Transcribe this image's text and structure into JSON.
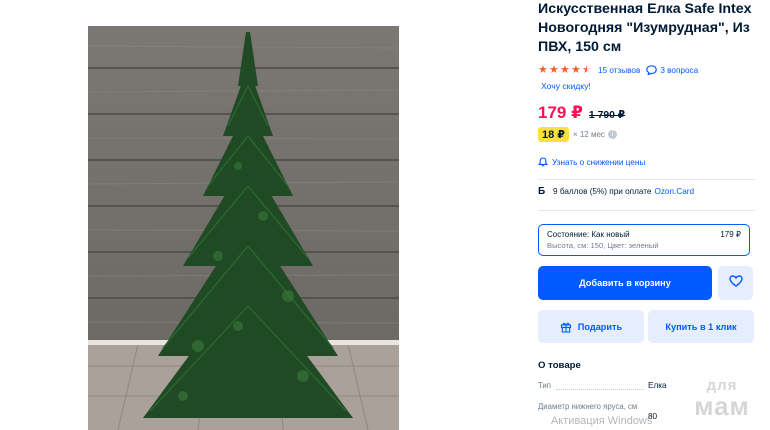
{
  "product": {
    "title": "Искусственная Елка Safe Intex Новогодняя \"Изумрудная\", Из ПВХ, 150 см",
    "rating_stars": 4.5,
    "reviews_link": "15 отзывов",
    "questions_link": "3 вопроса",
    "discount_link": "Хочу скидку!",
    "price": "179 ₽",
    "old_price": "1 790 ₽",
    "installment_amount": "18 ₽",
    "installment_term": "× 12 мес",
    "info_icon_glyph": "i",
    "notify_link": "Узнать о снижении цены",
    "bonus_icon": "Б",
    "bonus_text": "9 баллов (5%) при оплате",
    "bonus_link": "Ozon.Card"
  },
  "variant": {
    "condition": "Состояние: Как новый",
    "price": "179 ₽",
    "details": "Высота, см: 150, Цвет: зеленый"
  },
  "actions": {
    "add_to_cart": "Добавить в корзину",
    "gift": "Подарить",
    "buy_one_click": "Купить в 1 клик"
  },
  "about": {
    "title": "О товаре",
    "specs": [
      {
        "label": "Тип",
        "value": "Елка"
      },
      {
        "label": "Диаметр нижнего яруса, см",
        "value": "80"
      }
    ]
  },
  "overlays": {
    "activation_text": "Активация Windows",
    "watermark_top": "для",
    "watermark_bottom": "мам"
  },
  "colors": {
    "accent": "#005bff",
    "price": "#f91155",
    "star": "#f85f2a",
    "installment_badge": "#ffdf3a"
  },
  "icons": [
    "star-icon",
    "question-bubble-icon",
    "info-icon",
    "bell-icon",
    "bonus-icon",
    "heart-icon",
    "gift-icon"
  ]
}
